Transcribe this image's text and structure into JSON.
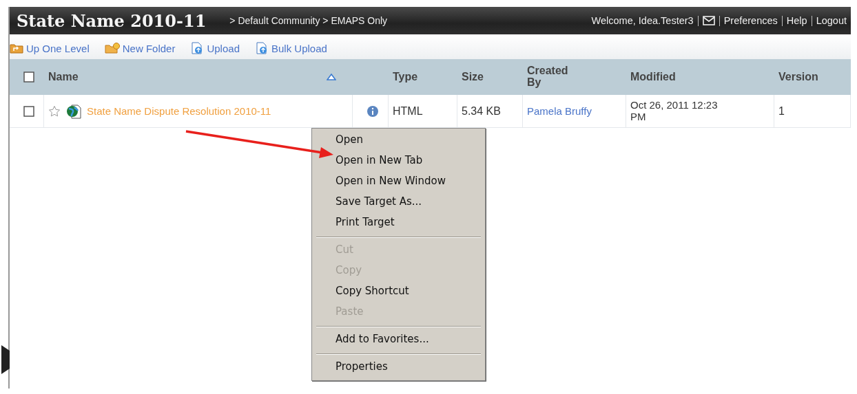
{
  "header": {
    "title": "State Name 2010-11",
    "breadcrumb": "> Default Community > EMAPS Only",
    "welcome": "Welcome, Idea.Tester3",
    "links": [
      "Preferences",
      "Help",
      "Logout"
    ]
  },
  "toolbar": [
    {
      "label": "Up One Level",
      "kind": "up"
    },
    {
      "label": "New Folder",
      "kind": "folder"
    },
    {
      "label": "Upload",
      "kind": "upload"
    },
    {
      "label": "Bulk Upload",
      "kind": "upload"
    }
  ],
  "table": {
    "select_all": {
      "checked": false
    },
    "columns": [
      "Name",
      "Type",
      "Size",
      "Created By",
      "Modified",
      "Version"
    ],
    "rows": [
      {
        "checked": false,
        "starred": false,
        "name": "State Name Dispute Resolution 2010-11",
        "type": "HTML",
        "size": "5.34 KB",
        "created_by": "Pamela Bruffy",
        "modified": "Oct 26, 2011 12:23 PM",
        "version": "1"
      }
    ]
  },
  "context_menu": [
    {
      "kind": "item",
      "label": "Open",
      "disabled": false
    },
    {
      "kind": "item",
      "label": "Open in New Tab",
      "disabled": false
    },
    {
      "kind": "item",
      "label": "Open in New Window",
      "disabled": false
    },
    {
      "kind": "item",
      "label": "Save Target As...",
      "disabled": false
    },
    {
      "kind": "item",
      "label": "Print Target",
      "disabled": false
    },
    {
      "kind": "separator"
    },
    {
      "kind": "item",
      "label": "Cut",
      "disabled": true
    },
    {
      "kind": "item",
      "label": "Copy",
      "disabled": true
    },
    {
      "kind": "item",
      "label": "Copy Shortcut",
      "disabled": false
    },
    {
      "kind": "item",
      "label": "Paste",
      "disabled": true
    },
    {
      "kind": "separator"
    },
    {
      "kind": "item",
      "label": "Add to Favorites...",
      "disabled": false
    },
    {
      "kind": "separator"
    },
    {
      "kind": "item",
      "label": "Properties",
      "disabled": false
    }
  ]
}
